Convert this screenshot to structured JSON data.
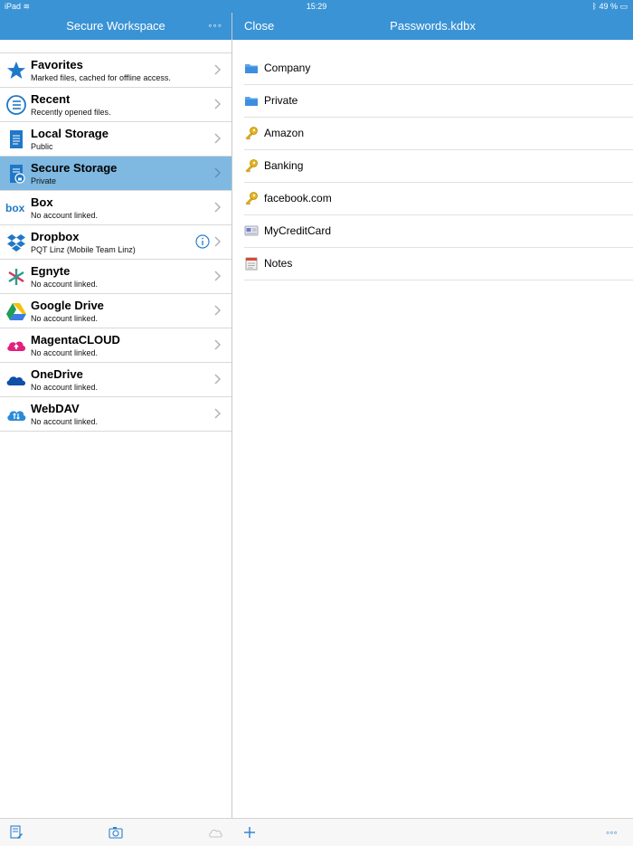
{
  "status_bar": {
    "device": "iPad",
    "time": "15:29",
    "battery": "49 %"
  },
  "left_panel": {
    "title": "Secure Workspace",
    "more_label": "◦◦◦",
    "items": [
      {
        "title": "Favorites",
        "subtitle": "Marked files, cached for offline access.",
        "icon": "star-icon"
      },
      {
        "title": "Recent",
        "subtitle": "Recently opened files.",
        "icon": "recent-list-icon"
      },
      {
        "title": "Local Storage",
        "subtitle": "Public",
        "icon": "document-icon"
      },
      {
        "title": "Secure Storage",
        "subtitle": "Private",
        "icon": "secure-document-icon",
        "selected": true
      },
      {
        "title": "Box",
        "subtitle": "No account linked.",
        "icon": "box-logo-icon"
      },
      {
        "title": "Dropbox",
        "subtitle": "PQT Linz (Mobile Team Linz)",
        "icon": "dropbox-logo-icon",
        "has_info": true
      },
      {
        "title": "Egnyte",
        "subtitle": "No account linked.",
        "icon": "egnyte-logo-icon"
      },
      {
        "title": "Google Drive",
        "subtitle": "No account linked.",
        "icon": "google-drive-logo-icon"
      },
      {
        "title": "MagentaCLOUD",
        "subtitle": "No account linked.",
        "icon": "magenta-cloud-icon"
      },
      {
        "title": "OneDrive",
        "subtitle": "No account linked.",
        "icon": "onedrive-logo-icon"
      },
      {
        "title": "WebDAV",
        "subtitle": "No account linked.",
        "icon": "webdav-cloud-icon"
      }
    ]
  },
  "right_panel": {
    "close_label": "Close",
    "title": "Passwords.kdbx",
    "items": [
      {
        "label": "Company",
        "icon": "folder-icon"
      },
      {
        "label": "Private",
        "icon": "folder-icon"
      },
      {
        "label": "Amazon",
        "icon": "key-icon"
      },
      {
        "label": "Banking",
        "icon": "key-icon"
      },
      {
        "label": "facebook.com",
        "icon": "key-icon"
      },
      {
        "label": "MyCreditCard",
        "icon": "card-icon"
      },
      {
        "label": "Notes",
        "icon": "notes-icon"
      }
    ]
  },
  "bottom_toolbar": {
    "more_label": "◦◦◦"
  },
  "colors": {
    "accent": "#3a93d5",
    "selected_row": "#7fb8e1",
    "link_blue": "#2a7fcf"
  }
}
